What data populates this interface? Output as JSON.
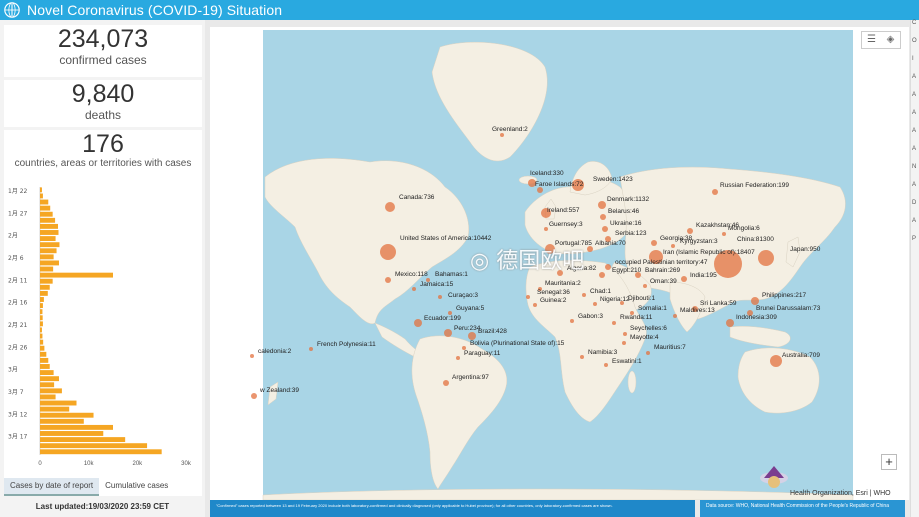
{
  "header": {
    "title": "Novel Coronavirus (COVID-19) Situation"
  },
  "stats": {
    "confirmed": {
      "value": "234,073",
      "label": "confirmed cases"
    },
    "deaths": {
      "value": "9,840",
      "label": "deaths"
    },
    "countries": {
      "value": "176",
      "label": "countries, areas or territories with cases"
    }
  },
  "tabs": {
    "by_date": "Cases by date of report",
    "cumulative": "Cumulative cases"
  },
  "last_updated": "Last updated:19/03/2020 23:59 CET",
  "colors": {
    "header": "#29a9e0",
    "bars": "#f5a623",
    "circles": "#e3723f"
  },
  "chart_data": {
    "type": "bar",
    "orientation": "horizontal",
    "categories": [
      "1月 22",
      "1月 27",
      "2月",
      "2月 6",
      "2月 11",
      "2月 16",
      "2月 21",
      "2月 26",
      "3月",
      "3月 7",
      "3月 12",
      "3月 17"
    ],
    "xticks": [
      "0",
      "10k",
      "20k",
      "30k"
    ],
    "xlim": [
      0,
      30000
    ],
    "series": [
      {
        "values": [
          400,
          600,
          1700,
          2100,
          2600,
          3100,
          3700,
          3800,
          3200,
          4000,
          3400,
          2800,
          3900,
          2700,
          15000,
          2600,
          2000,
          1600,
          800,
          600,
          500,
          550,
          600,
          400,
          500,
          650,
          900,
          1300,
          1700,
          2000,
          2800,
          3900,
          2900,
          4500,
          3200,
          7500,
          6000,
          11000,
          9000,
          15000,
          13000,
          17500,
          22000,
          25000
        ]
      }
    ]
  },
  "map": {
    "labels": [
      {
        "text": "Greenland:2"
      },
      {
        "text": "Iceland:330"
      },
      {
        "text": "Faroe Islands:72"
      },
      {
        "text": "Sweden:1423"
      },
      {
        "text": "Russian Federation:199"
      },
      {
        "text": "Canada:736"
      },
      {
        "text": "Denmark:1132"
      },
      {
        "text": "Ireland:557"
      },
      {
        "text": "Belarus:46"
      },
      {
        "text": "Guernsey:3"
      },
      {
        "text": "Ukraine:16"
      },
      {
        "text": "Kazakhstan:46"
      },
      {
        "text": "Mongolia:6"
      },
      {
        "text": "Serbia:123"
      },
      {
        "text": "Georgia:38"
      },
      {
        "text": "Kyrgyzstan:3"
      },
      {
        "text": "China:81300"
      },
      {
        "text": "United States of America:10442"
      },
      {
        "text": "Portugal:785"
      },
      {
        "text": "Albania:70"
      },
      {
        "text": "Japan:950"
      },
      {
        "text": "Iran (Islamic Republic of):18407"
      },
      {
        "text": "occupied Palestinian territory:47"
      },
      {
        "text": "Egypt:210"
      },
      {
        "text": "Bahrain:269"
      },
      {
        "text": "Algeria:82"
      },
      {
        "text": "India:195"
      },
      {
        "text": "Mexico:118"
      },
      {
        "text": "Bahamas:1"
      },
      {
        "text": "Oman:39"
      },
      {
        "text": "Jamaica:15"
      },
      {
        "text": "Mauritania:2"
      },
      {
        "text": "Curaçao:3"
      },
      {
        "text": "Chad:1"
      },
      {
        "text": "Senegal:36"
      },
      {
        "text": "Djibouti:1"
      },
      {
        "text": "Guinea:2"
      },
      {
        "text": "Nigeria:12"
      },
      {
        "text": "Philippines:217"
      },
      {
        "text": "Guyana:5"
      },
      {
        "text": "Sri Lanka:59"
      },
      {
        "text": "Brunei Darussalam:73"
      },
      {
        "text": "Ecuador:199"
      },
      {
        "text": "Somalia:1"
      },
      {
        "text": "Maldives:13"
      },
      {
        "text": "Gabon:3"
      },
      {
        "text": "Rwanda:11"
      },
      {
        "text": "Indonesia:309"
      },
      {
        "text": "Peru:234"
      },
      {
        "text": "Brazil:428"
      },
      {
        "text": "Seychelles:6"
      },
      {
        "text": "French Polynesia:11"
      },
      {
        "text": "Mayotte:4"
      },
      {
        "text": "Bolivia (Plurinational State of):15"
      },
      {
        "text": "caledonia:2"
      },
      {
        "text": "Mauritius:7"
      },
      {
        "text": "Paraguay:11"
      },
      {
        "text": "Namibia:3"
      },
      {
        "text": "Eswatini:1"
      },
      {
        "text": "Australia:709"
      },
      {
        "text": "Argentina:97"
      },
      {
        "text": "w Zealand:39"
      }
    ]
  },
  "bottom": {
    "note": "\"Confirmed\" cases reported between 13 and 19 February 2020 include both laboratory-confirmed and clinically diagnosed (only applicable to Hubei province); for all other countries, only laboratory-confirmed cases are shown.",
    "data_source": "Data source: WHO, National Health Commission of the People's Republic of China",
    "source_line": "Health Organization, Esri | WHO"
  },
  "watermark": "德国欧吧",
  "rail_labels": [
    "C",
    "O",
    "I",
    "A",
    "A",
    "A",
    "A",
    "A",
    "N",
    "A",
    "D",
    "A",
    "P"
  ]
}
